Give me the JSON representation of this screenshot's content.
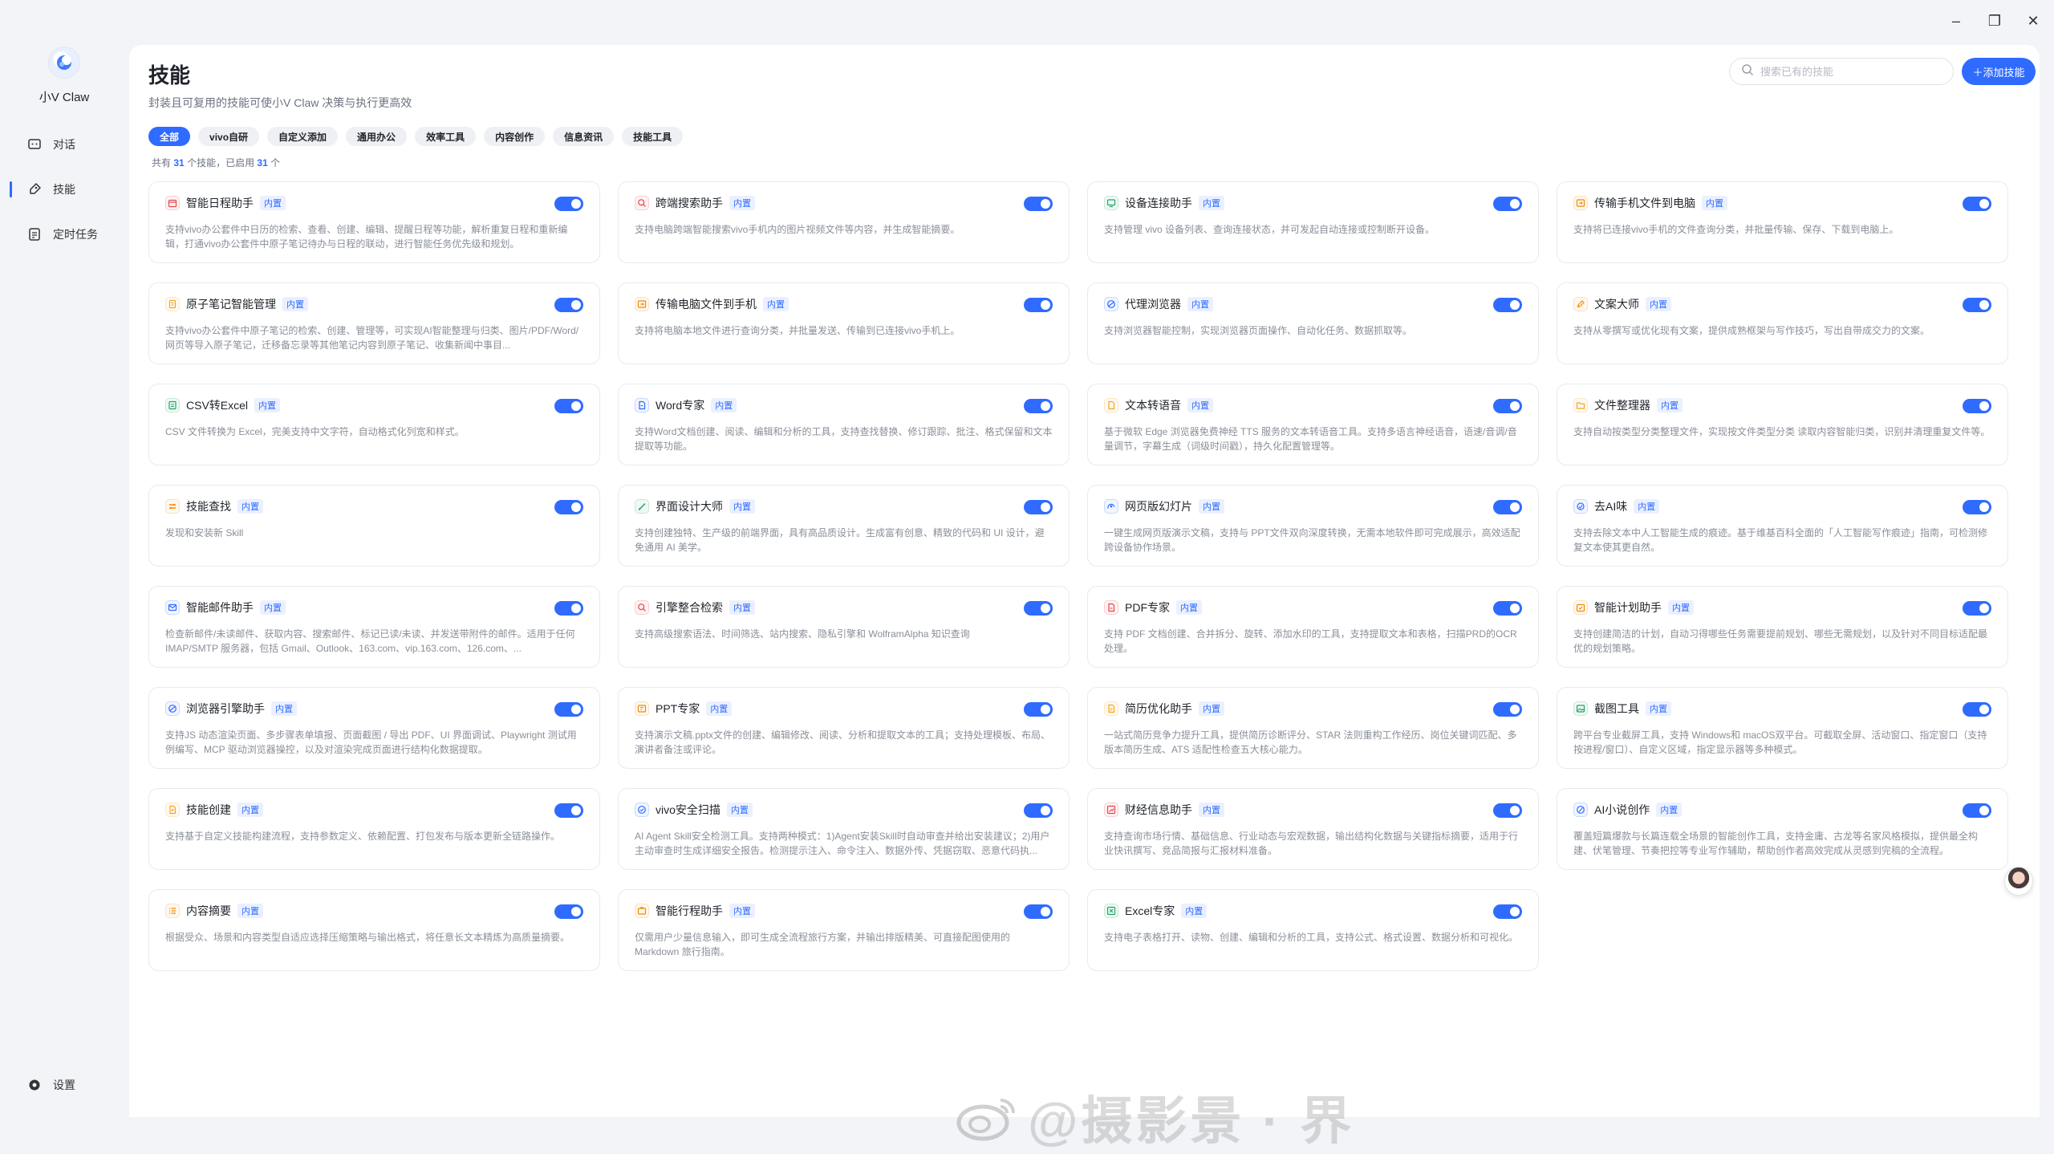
{
  "app": {
    "name": "小V Claw"
  },
  "window_controls": {
    "minimize": "–",
    "restore": "❐",
    "close": "✕"
  },
  "nav": [
    {
      "label": "对话",
      "icon": "chat-icon"
    },
    {
      "label": "技能",
      "icon": "skill-icon",
      "active": true
    },
    {
      "label": "定时任务",
      "icon": "schedule-icon"
    }
  ],
  "settings_label": "设置",
  "page": {
    "title": "技能",
    "subtitle": "封装且可复用的技能可使小V Claw 决策与执行更高效",
    "search_placeholder": "搜索已有的技能",
    "add_label": "＋添加技能"
  },
  "filters": [
    "全部",
    "vivo自研",
    "自定义添加",
    "通用办公",
    "效率工具",
    "内容创作",
    "信息资讯",
    "技能工具"
  ],
  "counts": {
    "prefix": "共有",
    "total": "31",
    "mid": "个技能，已启用",
    "enabled": "31",
    "suffix": "个"
  },
  "badge_label": "内置",
  "skills": [
    {
      "name": "智能日程助手",
      "icon": "calendar-icon",
      "color": "#e5484d",
      "desc": "支持vivo办公套件中日历的检索、查看、创建、编辑、提醒日程等功能，解析重复日程和重新编辑，打通vivo办公套件中原子笔记待办与日程的联动，进行智能任务优先级和规划。"
    },
    {
      "name": "跨端搜索助手",
      "icon": "search-icon",
      "color": "#e5484d",
      "desc": "支持电脑跨端智能搜索vivo手机内的图片视频文件等内容，并生成智能摘要。"
    },
    {
      "name": "设备连接助手",
      "icon": "device-icon",
      "color": "#21a366",
      "desc": "支持管理 vivo 设备列表、查询连接状态，并可发起自动连接或控制断开设备。"
    },
    {
      "name": "传输手机文件到电脑",
      "icon": "transfer-icon",
      "color": "#f08c00",
      "desc": "支持将已连接vivo手机的文件查询分类，并批量传输、保存、下载到电脑上。"
    },
    {
      "name": "原子笔记智能管理",
      "icon": "note-icon",
      "color": "#f5a623",
      "desc": "支持vivo办公套件中原子笔记的检索、创建、管理等，可实现AI智能整理与归类、图片/PDF/Word/网页等导入原子笔记，迁移备忘录等其他笔记内容到原子笔记、收集新闻中事目..."
    },
    {
      "name": "传输电脑文件到手机",
      "icon": "transfer-icon",
      "color": "#f08c00",
      "desc": "支持将电脑本地文件进行查询分类，并批量发送、传输到已连接vivo手机上。"
    },
    {
      "name": "代理浏览器",
      "icon": "browser-icon",
      "color": "#2f6bff",
      "desc": "支持浏览器智能控制，实现浏览器页面操作、自动化任务、数据抓取等。"
    },
    {
      "name": "文案大师",
      "icon": "pen-icon",
      "color": "#f08c00",
      "desc": "支持从零撰写或优化现有文案，提供成熟框架与写作技巧，写出自带成交力的文案。"
    },
    {
      "name": "CSV转Excel",
      "icon": "sheet-icon",
      "color": "#21a366",
      "desc": "CSV 文件转换为 Excel，完美支持中文字符，自动格式化列宽和样式。"
    },
    {
      "name": "Word专家",
      "icon": "doc-icon",
      "color": "#2f6bff",
      "desc": "支持Word文档创建、阅读、编辑和分析的工具，支持查找替换、修订跟踪、批注、格式保留和文本提取等功能。"
    },
    {
      "name": "文本转语音",
      "icon": "file-icon",
      "color": "#f5a623",
      "desc": "基于微软 Edge 浏览器免费神经 TTS 服务的文本转语音工具。支持多语言神经语音，语速/音调/音量调节，字幕生成（词级时间戳），持久化配置管理等。"
    },
    {
      "name": "文件整理器",
      "icon": "folder-icon",
      "color": "#f5a623",
      "desc": "支持自动按类型分类整理文件，实现按文件类型分类 读取内容智能归类，识别并清理重复文件等。"
    },
    {
      "name": "技能查找",
      "icon": "compass-icon",
      "color": "#f08c00",
      "desc": "发现和安装新 Skill"
    },
    {
      "name": "界面设计大师",
      "icon": "brush-icon",
      "color": "#21a366",
      "desc": "支持创建独特、生产级的前端界面，具有高品质设计。生成富有创意、精致的代码和 UI 设计，避免通用 AI 美学。"
    },
    {
      "name": "网页版幻灯片",
      "icon": "slides-icon",
      "color": "#2f6bff",
      "desc": "一键生成网页版演示文稿，支持与 PPT文件双向深度转换，无需本地软件即可完成展示，高效适配跨设备协作场景。"
    },
    {
      "name": "去AI味",
      "icon": "sparkle-icon",
      "color": "#2f6bff",
      "desc": "支持去除文本中人工智能生成的痕迹。基于维基百科全面的「人工智能写作痕迹」指南，可检测修复文本使其更自然。"
    },
    {
      "name": "智能邮件助手",
      "icon": "mail-icon",
      "color": "#2f6bff",
      "desc": "检查新邮件/未读邮件、获取内容、搜索邮件、标记已读/未读、并发送带附件的邮件。适用于任何 IMAP/SMTP 服务器，包括 Gmail、Outlook、163.com、vip.163.com、126.com、..."
    },
    {
      "name": "引擎整合检索",
      "icon": "search-icon",
      "color": "#e5484d",
      "desc": "支持高级搜索语法、时间筛选、站内搜索、隐私引擎和 WolframAlpha 知识查询"
    },
    {
      "name": "PDF专家",
      "icon": "pdf-icon",
      "color": "#e5484d",
      "desc": "支持 PDF 文档创建、合并拆分、旋转、添加水印的工具，支持提取文本和表格，扫描PRD的OCR处理。"
    },
    {
      "name": "智能计划助手",
      "icon": "plan-icon",
      "color": "#f08c00",
      "desc": "支持创建简洁的计划，自动习得哪些任务需要提前规划、哪些无需规划，以及针对不同目标适配最优的规划策略。"
    },
    {
      "name": "浏览器引擎助手",
      "icon": "browser-icon",
      "color": "#2f6bff",
      "desc": "支持JS 动态渲染页面、多步骤表单填报、页面截图 / 导出 PDF、UI 界面调试、Playwright 测试用例编写、MCP 驱动浏览器操控，以及对渲染完成页面进行结构化数据提取。"
    },
    {
      "name": "PPT专家",
      "icon": "ppt-icon",
      "color": "#f08c00",
      "desc": "支持演示文稿.pptx文件的创建、编辑修改、阅读、分析和提取文本的工具；支持处理模板、布局、演讲者备注或评论。"
    },
    {
      "name": "简历优化助手",
      "icon": "resume-icon",
      "color": "#f5a623",
      "desc": "一站式简历竞争力提升工具，提供简历诊断评分、STAR 法则重构工作经历、岗位关键词匹配、多版本简历生成、ATS 适配性检查五大核心能力。"
    },
    {
      "name": "截图工具",
      "icon": "image-icon",
      "color": "#21a366",
      "desc": "跨平台专业截屏工具，支持 Windows和 macOS双平台。可截取全屏、活动窗口、指定窗口（支持按进程/窗口）、自定义区域，指定显示器等多种模式。"
    },
    {
      "name": "技能创建",
      "icon": "create-icon",
      "color": "#f5a623",
      "desc": "支持基于自定义技能构建流程，支持参数定义、依赖配置、打包发布与版本更新全链路操作。"
    },
    {
      "name": "vivo安全扫描",
      "icon": "shield-icon",
      "color": "#2f6bff",
      "desc": "AI Agent Skill安全检测工具。支持两种模式：1)Agent安装Skill时自动审查并给出安装建议；2)用户主动审查时生成详细安全报告。检测提示注入、命令注入、数据外传、凭据窃取、恶意代码执..."
    },
    {
      "name": "财经信息助手",
      "icon": "finance-icon",
      "color": "#e5484d",
      "desc": "支持查询市场行情、基础信息、行业动态与宏观数据，输出结构化数据与关键指标摘要，适用于行业快讯撰写、竞品简报与汇报材料准备。"
    },
    {
      "name": "AI小说创作",
      "icon": "quill-icon",
      "color": "#2f6bff",
      "desc": "覆盖短篇爆款与长篇连载全场景的智能创作工具，支持金庸、古龙等名家风格模拟，提供最全构建、伏笔管理、节奏把控等专业写作辅助，帮助创作者高效完成从灵感到完稿的全流程。"
    },
    {
      "name": "内容摘要",
      "icon": "list-icon",
      "color": "#f08c00",
      "desc": "根据受众、场景和内容类型自适应选择压缩策略与输出格式，将任意长文本精炼为高质量摘要。"
    },
    {
      "name": "智能行程助手",
      "icon": "trip-icon",
      "color": "#f08c00",
      "desc": "仅需用户少量信息输入，即可生成全流程旅行方案，并输出排版精美、可直接配图使用的 Markdown 旅行指南。"
    },
    {
      "name": "Excel专家",
      "icon": "excel-icon",
      "color": "#21a366",
      "desc": "支持电子表格打开、读物、创建、编辑和分析的工具，支持公式、格式设置、数据分析和可视化。"
    }
  ],
  "watermark": "@摄影景 · 界"
}
